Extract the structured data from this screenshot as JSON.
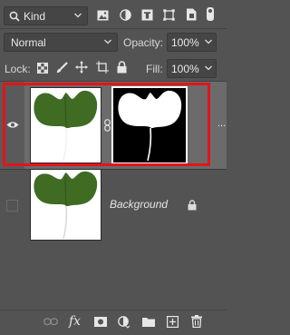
{
  "filter": {
    "kind_label": "Kind",
    "icons": [
      "image-filter-icon",
      "adjustment-filter-icon",
      "type-filter-icon",
      "shape-filter-icon",
      "smart-object-filter-icon",
      "filter-toggle-icon"
    ]
  },
  "blend": {
    "mode": "Normal",
    "opacity_label": "Opacity:",
    "opacity_value": "100%"
  },
  "lock": {
    "label": "Lock:",
    "fill_label": "Fill:",
    "fill_value": "100%"
  },
  "layers": [
    {
      "name": "",
      "visible": true,
      "selected": true,
      "has_mask": true
    },
    {
      "name": "Background",
      "visible": false,
      "selected": false,
      "locked": true
    }
  ],
  "menu": {
    "more_label": "..."
  },
  "footer": {
    "fx_label": "fx",
    "icons": [
      "link-layers-icon",
      "fx-icon",
      "add-mask-icon",
      "adjustment-layer-icon",
      "group-folder-icon",
      "new-layer-icon",
      "trash-icon"
    ]
  },
  "colors": {
    "panel": "#535353",
    "selected_row": "#6b6b6b",
    "highlight": "#e3141a",
    "leaf": "#3f6b22"
  }
}
